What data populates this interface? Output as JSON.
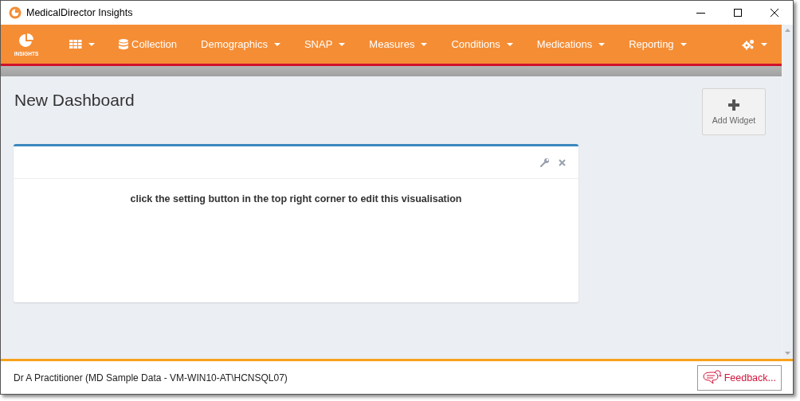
{
  "window": {
    "title": "MedicalDirector Insights"
  },
  "brand": {
    "label": "INSIGHTS"
  },
  "nav": [
    {
      "kind": "grid",
      "dropdown": true
    },
    {
      "kind": "database",
      "label": "Collection",
      "dropdown": false
    },
    {
      "kind": "text",
      "label": "Demographics",
      "dropdown": true
    },
    {
      "kind": "text",
      "label": "SNAP",
      "dropdown": true
    },
    {
      "kind": "text",
      "label": "Measures",
      "dropdown": true
    },
    {
      "kind": "text",
      "label": "Conditions",
      "dropdown": true
    },
    {
      "kind": "text",
      "label": "Medications",
      "dropdown": true
    },
    {
      "kind": "text",
      "label": "Reporting",
      "dropdown": true
    }
  ],
  "settings_menu": {
    "dropdown": true
  },
  "dashboard": {
    "title": "New Dashboard",
    "add_widget": "Add Widget"
  },
  "widget": {
    "message": "click the setting button in the top right corner to edit this visualisation"
  },
  "status_bar": {
    "text": "Dr A Practitioner (MD Sample Data - VM-WIN10-AT\\HCNSQL07)",
    "feedback": "Feedback..."
  }
}
